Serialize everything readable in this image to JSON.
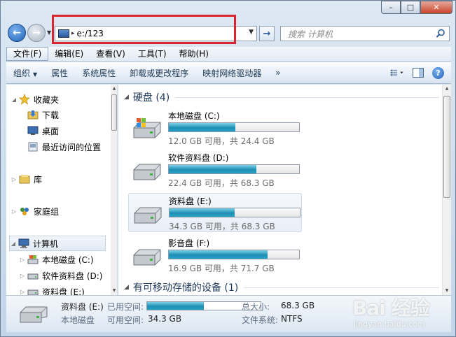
{
  "window": {
    "caption_buttons": [
      "–",
      "□",
      "✕"
    ]
  },
  "nav": {
    "address_path": "e:/123",
    "address_chevron": "▸",
    "search_placeholder": "搜索 计算机"
  },
  "menubar": [
    {
      "label": "文件(F)"
    },
    {
      "label": "编辑(E)"
    },
    {
      "label": "查看(V)"
    },
    {
      "label": "工具(T)"
    },
    {
      "label": "帮助(H)"
    }
  ],
  "toolbar": {
    "organize": "组织",
    "properties": "属性",
    "system_properties": "系统属性",
    "uninstall": "卸载或更改程序",
    "map_drive": "映射网络驱动器",
    "more": "»",
    "help": "?"
  },
  "sidebar": {
    "favorites": "收藏夹",
    "downloads": "下载",
    "desktop": "桌面",
    "recent": "最近访问的位置",
    "libraries": "库",
    "homegroup": "家庭组",
    "computer": "计算机",
    "drive_c": "本地磁盘 (C:)",
    "drive_d": "软件资料盘 (D:)",
    "drive_e": "资料盘 (E:)"
  },
  "content": {
    "hard_disks_header": "硬盘 (4)",
    "removable_header": "有可移动存储的设备 (1)",
    "drives": [
      {
        "name": "本地磁盘 (C:)",
        "size_text": "12.0 GB 可用，共 24.4 GB",
        "used_fraction": 0.51,
        "selected": false,
        "windows_logo": true
      },
      {
        "name": "软件资料盘 (D:)",
        "size_text": "22.4 GB 可用，共 68.3 GB",
        "used_fraction": 0.67,
        "selected": false,
        "windows_logo": false
      },
      {
        "name": "资料盘 (E:)",
        "size_text": "34.3 GB 可用，共 68.3 GB",
        "used_fraction": 0.5,
        "selected": true,
        "windows_logo": false
      },
      {
        "name": "影音盘 (F:)",
        "size_text": "16.9 GB 可用，共 71.7 GB",
        "used_fraction": 0.76,
        "selected": false,
        "windows_logo": false
      }
    ]
  },
  "details": {
    "name": "资料盘 (E:)",
    "type": "本地磁盘",
    "used_label": "已用空间:",
    "free_label": "可用空间:",
    "free_value": "34.3 GB",
    "used_fraction": 0.5,
    "total_label": "总大小:",
    "total_value": "68.3 GB",
    "fs_label": "文件系统:",
    "fs_value": "NTFS"
  },
  "watermark": {
    "brand": "Bai 经验",
    "url": "jingyan.baidu.com"
  },
  "colors": {
    "highlight": "#d9262e",
    "drive_bar": "#1d8fb3",
    "header_text": "#1e395b"
  }
}
